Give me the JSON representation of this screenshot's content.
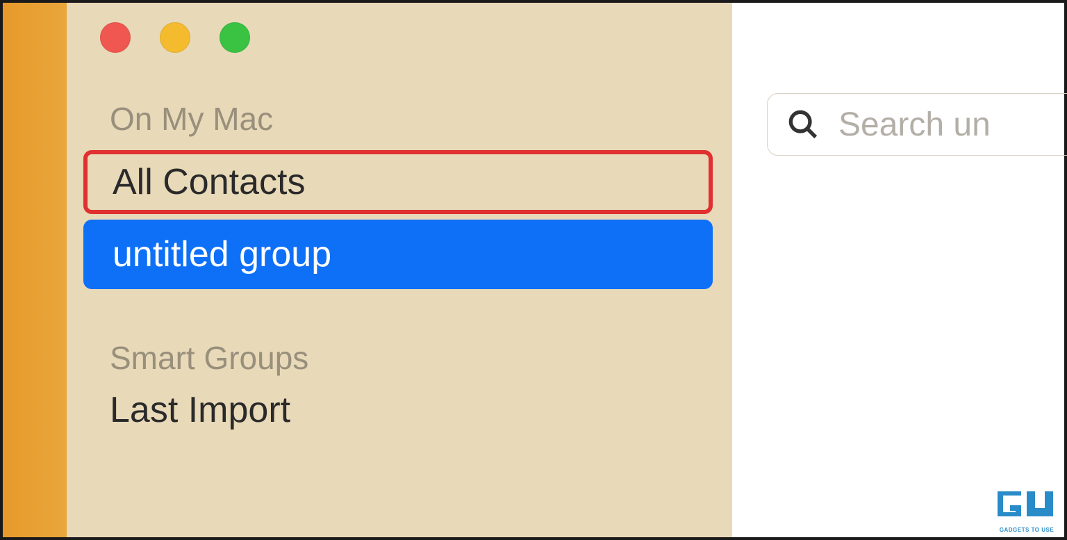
{
  "sidebar": {
    "section1_header": "On My Mac",
    "section2_header": "Smart Groups",
    "items": [
      {
        "label": "All Contacts",
        "highlighted": true
      },
      {
        "label": "untitled group",
        "selected": true
      }
    ],
    "smart_items": [
      {
        "label": "Last Import"
      }
    ]
  },
  "search": {
    "placeholder": "Search un"
  },
  "watermark": {
    "text": "GADGETS TO USE"
  },
  "colors": {
    "close": "#f05751",
    "minimize": "#f4bb2f",
    "zoom": "#3ac343",
    "selection": "#0e6ff7",
    "highlight_border": "#e03030",
    "sidebar_bg": "#e8d9b8"
  }
}
